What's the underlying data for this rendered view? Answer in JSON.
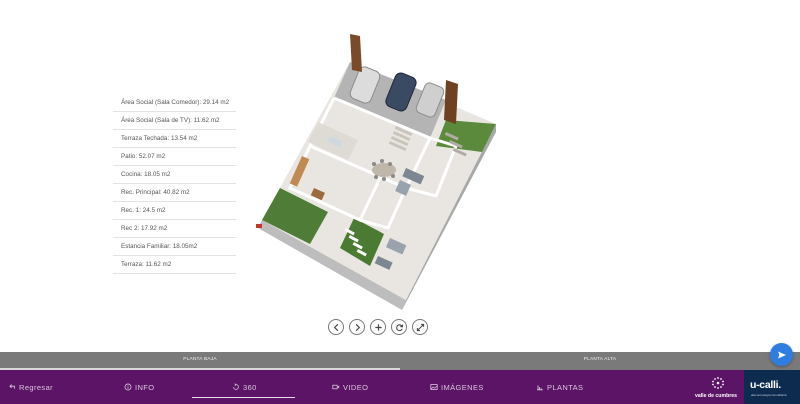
{
  "areas": [
    "Área Social (Sala Comedor): 29.14 m2",
    "Área Social (Sala de TV): 11.62 m2",
    "Terraza Techada: 13.54 m2",
    "Patio: 52.07 m2",
    "Cocina: 18.05 m2",
    "Rec. Principal: 40.82 m2",
    "Rec. 1: 24.5 m2",
    "Rec 2: 17.92 m2",
    "Estancia Familiar: 18.05m2",
    "Terraza: 11.62 m2"
  ],
  "floor_tabs": {
    "ground": "PLANTA BAJA",
    "upper": "PLANTA ALTA"
  },
  "nav": {
    "back": "Regresar",
    "info": "INFO",
    "tour": "360",
    "video": "VIDEO",
    "images": "IMÁGENES",
    "plans": "PLANTAS"
  },
  "brands": {
    "development": "valle de cumbres",
    "company": "u-calli.",
    "company_tagline": "alta tecnología inmobiliaria"
  },
  "colors": {
    "nav_background": "#5c1566",
    "floor_tab_background": "#7a7a7a",
    "fab": "#2f7de1",
    "company_background": "#0d2a4f"
  }
}
